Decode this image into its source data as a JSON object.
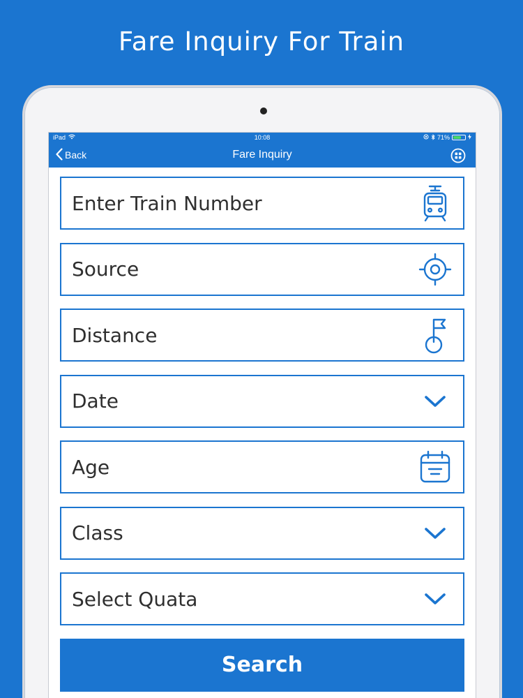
{
  "promo": {
    "title": "Fare Inquiry For Train"
  },
  "status_bar": {
    "device": "iPad",
    "time": "10:08",
    "battery": "71%",
    "battery_level": 0.71
  },
  "nav": {
    "back_label": "Back",
    "title": "Fare Inquiry"
  },
  "form": {
    "fields": [
      {
        "placeholder": "Enter Train Number",
        "icon": "train-icon"
      },
      {
        "placeholder": "Source",
        "icon": "target-icon"
      },
      {
        "placeholder": "Distance",
        "icon": "flag-icon"
      },
      {
        "placeholder": "Date",
        "icon": "chevron-down-icon"
      },
      {
        "placeholder": "Age",
        "icon": "calendar-icon"
      },
      {
        "placeholder": "Class",
        "icon": "chevron-down-icon"
      },
      {
        "placeholder": "Select Quata",
        "icon": "chevron-down-icon"
      }
    ],
    "search_label": "Search"
  },
  "colors": {
    "accent": "#1b75d0",
    "text": "#2f2f2f",
    "background": "#ffffff"
  }
}
